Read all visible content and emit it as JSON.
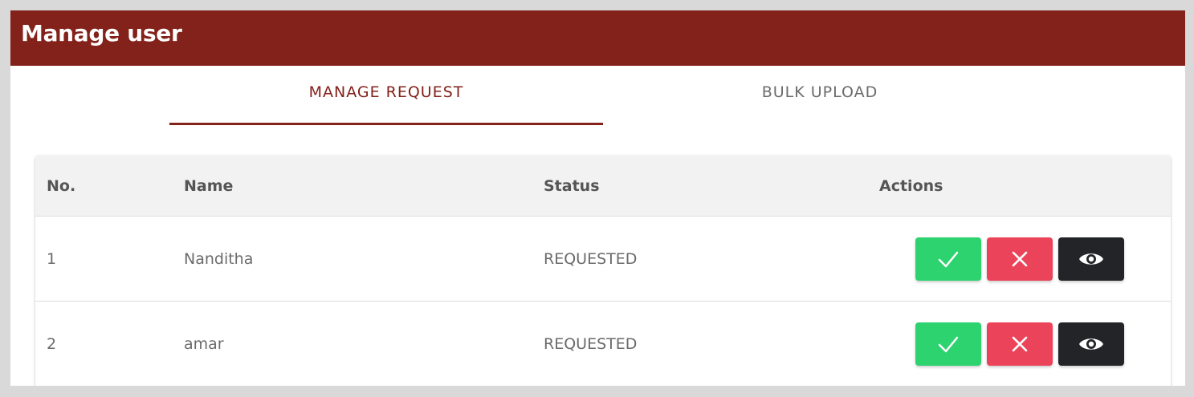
{
  "header": {
    "title": "Manage user"
  },
  "tabs": [
    {
      "label": "MANAGE REQUEST",
      "active": true
    },
    {
      "label": "BULK UPLOAD",
      "active": false
    }
  ],
  "table": {
    "columns": {
      "no": "No.",
      "name": "Name",
      "status": "Status",
      "actions": "Actions"
    },
    "rows": [
      {
        "no": "1",
        "name": "Nanditha",
        "status": "REQUESTED"
      },
      {
        "no": "2",
        "name": "amar",
        "status": "REQUESTED"
      }
    ],
    "row_actions": [
      "checkmark-icon",
      "close-icon",
      "eye-icon"
    ]
  },
  "colors": {
    "brand": "#83221a",
    "approve": "#2dd36f",
    "reject": "#eb445a",
    "view": "#222428"
  }
}
